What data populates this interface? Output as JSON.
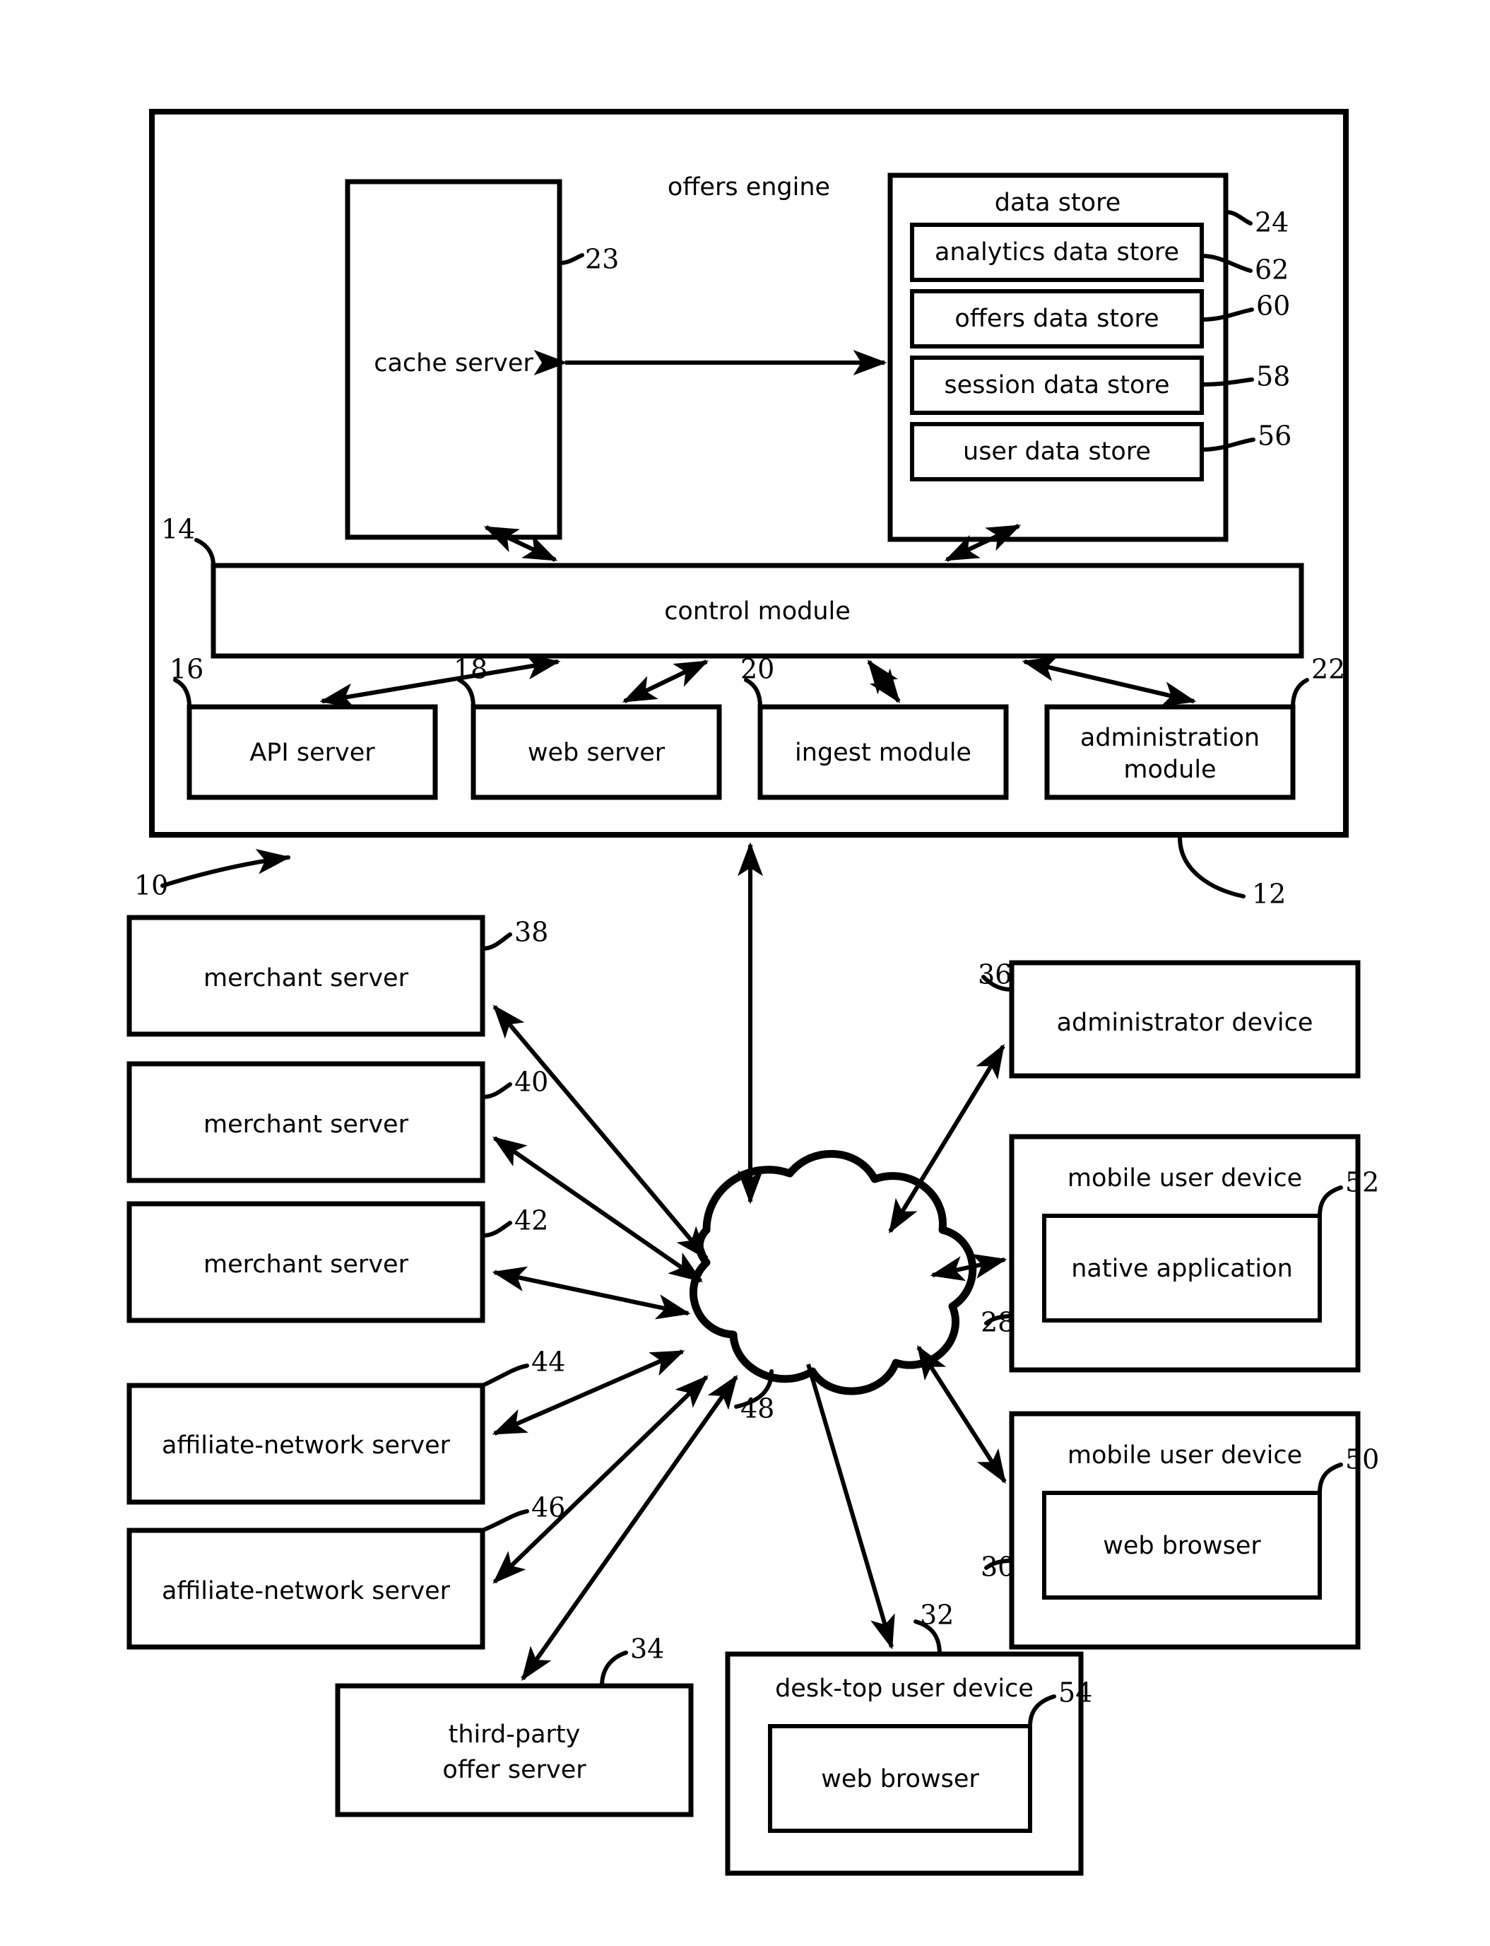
{
  "figure": {
    "title": "offers engine system block diagram",
    "system_ref": "10",
    "offers_engine_ref": "12"
  },
  "offers_engine": {
    "label": "offers engine",
    "cache_server": {
      "label": "cache server",
      "ref": "23"
    },
    "data_store": {
      "label": "data store",
      "ref": "24",
      "items": [
        {
          "label": "analytics data store",
          "ref": "62"
        },
        {
          "label": "offers data store",
          "ref": "60"
        },
        {
          "label": "session data store",
          "ref": "58"
        },
        {
          "label": "user data store",
          "ref": "56"
        }
      ]
    },
    "control_module": {
      "label": "control module",
      "ref": "14"
    },
    "modules": [
      {
        "label": "API server",
        "ref": "16"
      },
      {
        "label": "web server",
        "ref": "18"
      },
      {
        "label": "ingest module",
        "ref": "20"
      },
      {
        "label": "administration module",
        "ref": "22",
        "line1": "administration",
        "line2": "module"
      }
    ]
  },
  "network": {
    "label": "network cloud",
    "ref": "48"
  },
  "left_nodes": [
    {
      "label": "merchant server",
      "ref": "38"
    },
    {
      "label": "merchant server",
      "ref": "40"
    },
    {
      "label": "merchant server",
      "ref": "42"
    },
    {
      "label": "affiliate-network server",
      "ref": "44"
    },
    {
      "label": "affiliate-network server",
      "ref": "46"
    }
  ],
  "bottom_nodes": {
    "third_party": {
      "line1": "third-party",
      "line2": "offer server",
      "ref": "34"
    },
    "desktop": {
      "label": "desk-top user device",
      "ref": "32",
      "inner": {
        "label": "web browser",
        "ref": "54"
      }
    }
  },
  "right_nodes": {
    "administrator": {
      "label": "administrator device",
      "ref": "36"
    },
    "mobile_native": {
      "label": "mobile user device",
      "ref": "28",
      "inner": {
        "label": "native application",
        "ref": "52"
      }
    },
    "mobile_web": {
      "label": "mobile user device",
      "ref": "30",
      "inner": {
        "label": "web browser",
        "ref": "50"
      }
    }
  },
  "colors": {
    "stroke": "#000000",
    "fill": "#ffffff"
  }
}
